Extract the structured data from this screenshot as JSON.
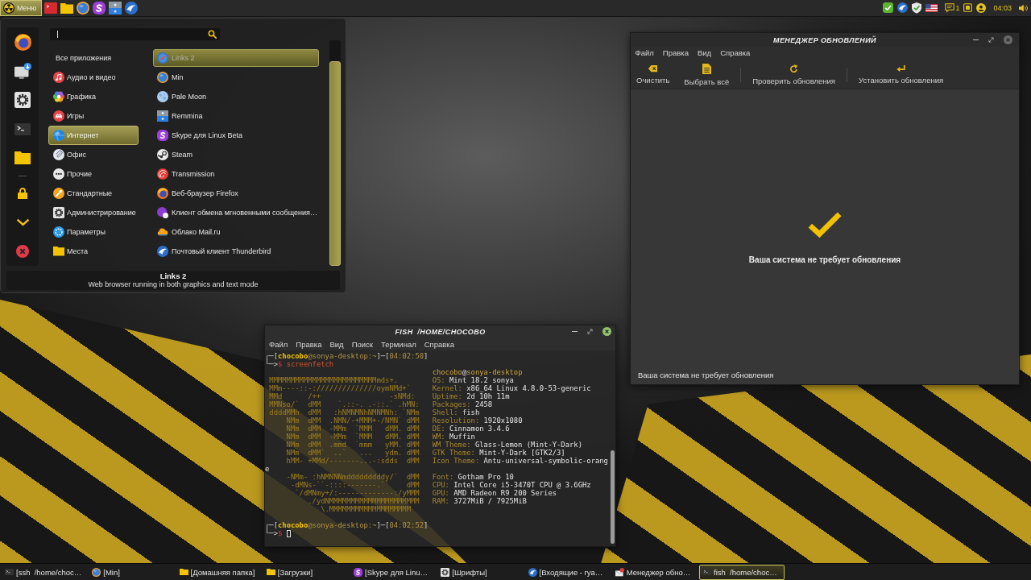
{
  "top_panel": {
    "menu_button": "Меню",
    "notification_count": "1",
    "clock": "04:03"
  },
  "app_menu": {
    "categories": [
      {
        "kind": "all",
        "label": "Все приложения",
        "selected": false
      },
      {
        "kind": "category",
        "label": "Аудио и видео",
        "selected": false
      },
      {
        "kind": "category",
        "label": "Графика",
        "selected": false
      },
      {
        "kind": "category",
        "label": "Игры",
        "selected": false
      },
      {
        "kind": "category",
        "label": "Интернет",
        "selected": true
      },
      {
        "kind": "category",
        "label": "Офис",
        "selected": false
      },
      {
        "kind": "category",
        "label": "Прочие",
        "selected": false
      },
      {
        "kind": "category",
        "label": "Стандартные",
        "selected": false
      },
      {
        "kind": "category",
        "label": "Администрирование",
        "selected": false
      },
      {
        "kind": "category",
        "label": "Параметры",
        "selected": false
      },
      {
        "kind": "category",
        "label": "Места",
        "selected": false
      }
    ],
    "apps": [
      {
        "label": "Links 2",
        "selected": true
      },
      {
        "label": "Min",
        "selected": false
      },
      {
        "label": "Pale Moon",
        "selected": false
      },
      {
        "label": "Remmina",
        "selected": false
      },
      {
        "label": "Skype для Linux Beta",
        "selected": false
      },
      {
        "label": "Steam",
        "selected": false
      },
      {
        "label": "Transmission",
        "selected": false
      },
      {
        "label": "Веб-браузер Firefox",
        "selected": false
      },
      {
        "label": "Клиент обмена мгновенными сообщения…",
        "selected": false
      },
      {
        "label": "Облако Mail.ru",
        "selected": false
      },
      {
        "label": "Почтовый клиент Thunderbird",
        "selected": false
      }
    ],
    "description": {
      "title": "Links 2",
      "text": "Web browser running in both graphics and text mode"
    }
  },
  "update_manager": {
    "title": "МЕНЕДЖЕР ОБНОВЛЕНИЙ",
    "menu": [
      "Файл",
      "Правка",
      "Вид",
      "Справка"
    ],
    "toolbar": [
      [
        "Очистить",
        "Выбрать всё"
      ],
      [
        "Проверить обновления"
      ],
      [
        "Установить обновления"
      ]
    ],
    "message": "Ваша система не требует обновления",
    "status": "Ваша система не требует обновления"
  },
  "terminal": {
    "title": "FISH  /HOME/CHOCOBO",
    "menu": [
      "Файл",
      "Правка",
      "Вид",
      "Поиск",
      "Терминал",
      "Справка"
    ],
    "lines": [
      {
        "kind": "prompt",
        "segments": [
          {
            "kind": "frame",
            "text": "┌─["
          },
          {
            "kind": "user",
            "text": "chocobo"
          },
          {
            "kind": "host",
            "text": "@sonya-desktop:~"
          },
          {
            "kind": "frame",
            "text": "]─["
          },
          {
            "kind": "time",
            "text": "04:02:50"
          },
          {
            "kind": "frame",
            "text": "]"
          }
        ]
      },
      {
        "kind": "prompt",
        "segments": [
          {
            "kind": "frame",
            "text": "└─>"
          },
          {
            "kind": "dollar",
            "text": "$"
          },
          {
            "kind": "command",
            "text": "screenfetch"
          }
        ]
      },
      {
        "kind": "info",
        "segments": [
          {
            "kind": "name",
            "text": "chocobo"
          },
          {
            "kind": "plain",
            "text": "@"
          },
          {
            "kind": "name",
            "text": "sonya-desktop"
          }
        ]
      },
      {
        "kind": "info",
        "art": "MMMMMMMMMMMMMMMMMMMMMMMMMmds+.",
        "segments": [
          {
            "kind": "label",
            "text": "OS:"
          },
          {
            "kind": "value",
            "text": "Mint 18.2 sonya"
          }
        ]
      },
      {
        "kind": "info",
        "art": "MMm----::-://////////////oymNMd+`",
        "segments": [
          {
            "kind": "label",
            "text": "Kernel:"
          },
          {
            "kind": "value",
            "text": "x86_64 Linux 4.8.0-53-generic"
          }
        ]
      },
      {
        "kind": "info",
        "art": "MMd      /++                -sNMd:",
        "segments": [
          {
            "kind": "label",
            "text": "Uptime:"
          },
          {
            "kind": "value",
            "text": "2d 10h 11m"
          }
        ]
      },
      {
        "kind": "info",
        "art": "MMNso/`  dMM    `.::-. .-::.` .hMN:",
        "segments": [
          {
            "kind": "label",
            "text": "Packages:"
          },
          {
            "kind": "value",
            "text": "2458"
          }
        ]
      },
      {
        "kind": "info",
        "art": "ddddMMh  dMM   :hNMNMNhNMNMNh: `NMm",
        "segments": [
          {
            "kind": "label",
            "text": "Shell:"
          },
          {
            "kind": "value",
            "text": "fish"
          }
        ]
      },
      {
        "kind": "info",
        "art": "    NMm  dMM  .NMN/-+MMM+-/NMN` dMM",
        "segments": [
          {
            "kind": "label",
            "text": "Resolution:"
          },
          {
            "kind": "value",
            "text": "1920x1080"
          }
        ]
      },
      {
        "kind": "info",
        "art": "    NMm  dMM  -MMm  `MMM   dMM. dMM",
        "segments": [
          {
            "kind": "label",
            "text": "DE:"
          },
          {
            "kind": "value",
            "text": "Cinnamon 3.4.6"
          }
        ]
      },
      {
        "kind": "info",
        "art": "    NMm  dMM  -MMm  `MMM   dMM. dMM",
        "segments": [
          {
            "kind": "label",
            "text": "WM:"
          },
          {
            "kind": "value",
            "text": "Muffin"
          }
        ]
      },
      {
        "kind": "info",
        "art": "    NMm  dMM  .mmd  `mmm   yMM. dMM",
        "segments": [
          {
            "kind": "label",
            "text": "WM Theme:"
          },
          {
            "kind": "value",
            "text": "Glass-Lemon (Mint-Y-Dark)"
          }
        ]
      },
      {
        "kind": "info",
        "art": "    NMm  dMM`  ..`   ...   ydm. dMM",
        "segments": [
          {
            "kind": "label",
            "text": "GTK Theme:"
          },
          {
            "kind": "value",
            "text": "Mint-Y-Dark [GTK2/3]"
          }
        ]
      },
      {
        "kind": "info",
        "art": "    hMM- +MMd/-------...-:sdds  dMM",
        "segments": [
          {
            "kind": "label",
            "text": "Icon Theme:"
          },
          {
            "kind": "value",
            "text": "Antu-universal-symbolic-orang"
          }
        ]
      },
      {
        "kind": "wrap",
        "segments": [
          {
            "kind": "value",
            "text": "e"
          }
        ]
      },
      {
        "kind": "info",
        "art": "    -NMm- :hNMNNNmdddddddddy/`  dMM",
        "segments": [
          {
            "kind": "label",
            "text": "Font:"
          },
          {
            "kind": "value",
            "text": "Gotham Pro 10"
          }
        ]
      },
      {
        "kind": "info",
        "art": "     -dMNs-``-::::-------.``    dMM",
        "segments": [
          {
            "kind": "label",
            "text": "CPU:"
          },
          {
            "kind": "value",
            "text": "Intel Core i5-3470T CPU @ 3.6GHz"
          }
        ]
      },
      {
        "kind": "info",
        "art": "      `/dMNmy+/:-------------:/yMMM",
        "segments": [
          {
            "kind": "label",
            "text": "GPU:"
          },
          {
            "kind": "value",
            "text": "AMD Radeon R9 200 Series"
          }
        ]
      },
      {
        "kind": "info",
        "art": "         ./ydNMMMMMMMMMMMMMMMMMMMMM",
        "segments": [
          {
            "kind": "label",
            "text": "RAM:"
          },
          {
            "kind": "value",
            "text": "3727MiB / 7925MiB"
          }
        ]
      },
      {
        "kind": "info",
        "art": "            \\.MMMMMMMMMMMMMMMMMMM"
      },
      {
        "kind": "blank"
      },
      {
        "kind": "prompt",
        "segments": [
          {
            "kind": "frame",
            "text": "┌─["
          },
          {
            "kind": "user",
            "text": "chocobo"
          },
          {
            "kind": "host",
            "text": "@sonya-desktop:~"
          },
          {
            "kind": "frame",
            "text": "]─["
          },
          {
            "kind": "time",
            "text": "04:02:52"
          },
          {
            "kind": "frame",
            "text": "]"
          }
        ]
      },
      {
        "kind": "prompt",
        "cursor": true,
        "segments": [
          {
            "kind": "frame",
            "text": "└─>"
          },
          {
            "kind": "dollar",
            "text": "$"
          }
        ]
      }
    ]
  },
  "taskbar": [
    {
      "label": "[ssh  /home/choc…",
      "selected": false
    },
    {
      "label": "[Min]",
      "selected": false
    },
    {
      "label": "[Домашняя папка]",
      "selected": false
    },
    {
      "label": "[Загрузки]",
      "selected": false
    },
    {
      "label": "[Skype для Linu…",
      "selected": false
    },
    {
      "label": "[Шрифты]",
      "selected": false
    },
    {
      "label": "[Входящие - rya…",
      "selected": false
    },
    {
      "label": "Менеджер обно…",
      "selected": false
    },
    {
      "label": "fish  /home/choc…",
      "selected": true
    }
  ]
}
